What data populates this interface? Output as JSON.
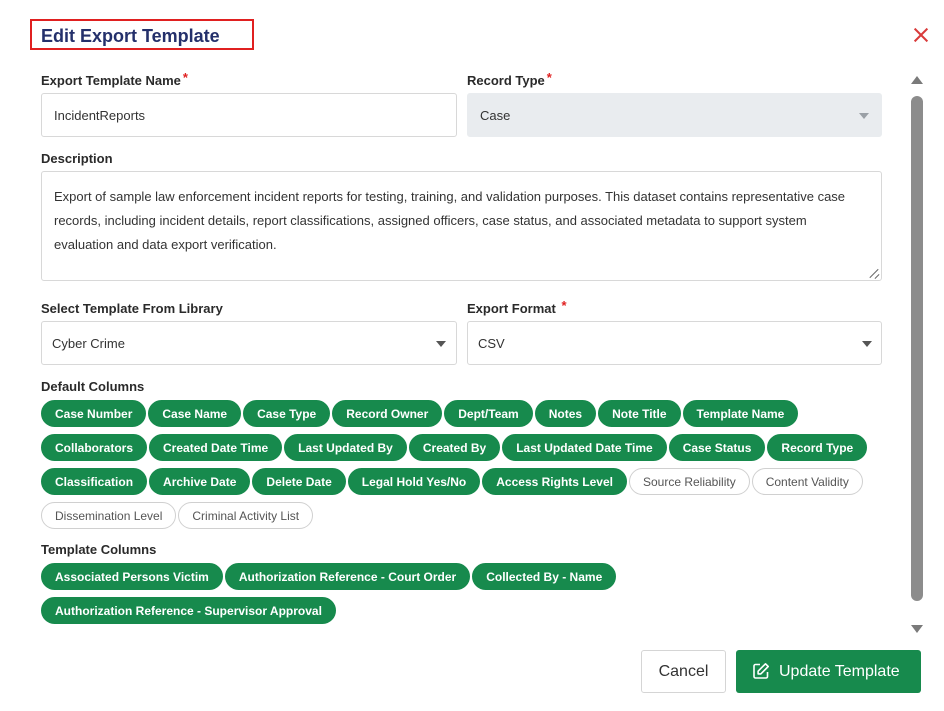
{
  "dialog": {
    "title": "Edit Export Template"
  },
  "fields": {
    "template_name": {
      "label": "Export Template Name",
      "required_mark": "*",
      "value": "IncidentReports"
    },
    "record_type": {
      "label": "Record Type",
      "required_mark": "*",
      "value": "Case",
      "disabled": true
    },
    "description": {
      "label": "Description",
      "value": "Export of sample law enforcement incident reports for testing, training, and validation purposes. This dataset contains representative case records, including incident details, report classifications, assigned officers, case status, and associated metadata to support system evaluation and data export verification."
    },
    "library_template": {
      "label": "Select Template From Library",
      "value": "Cyber Crime"
    },
    "export_format": {
      "label": "Export Format",
      "required_mark": "*",
      "value": "CSV"
    }
  },
  "default_columns": {
    "label": "Default Columns",
    "chips": [
      {
        "label": "Case Number",
        "selected": true
      },
      {
        "label": "Case Name",
        "selected": true
      },
      {
        "label": "Case Type",
        "selected": true
      },
      {
        "label": "Record Owner",
        "selected": true
      },
      {
        "label": "Dept/Team",
        "selected": true
      },
      {
        "label": "Notes",
        "selected": true
      },
      {
        "label": "Note Title",
        "selected": true
      },
      {
        "label": "Template Name",
        "selected": true
      },
      {
        "label": "Collaborators",
        "selected": true
      },
      {
        "label": "Created Date Time",
        "selected": true
      },
      {
        "label": "Last Updated By",
        "selected": true
      },
      {
        "label": "Created By",
        "selected": true
      },
      {
        "label": "Last Updated Date Time",
        "selected": true
      },
      {
        "label": "Case Status",
        "selected": true
      },
      {
        "label": "Record Type",
        "selected": true
      },
      {
        "label": "Classification",
        "selected": true
      },
      {
        "label": "Archive Date",
        "selected": true
      },
      {
        "label": "Delete Date",
        "selected": true
      },
      {
        "label": "Legal Hold Yes/No",
        "selected": true
      },
      {
        "label": "Access Rights Level",
        "selected": true
      },
      {
        "label": "Source Reliability",
        "selected": false
      },
      {
        "label": "Content Validity",
        "selected": false
      },
      {
        "label": "Dissemination Level",
        "selected": false
      },
      {
        "label": "Criminal Activity List",
        "selected": false
      }
    ]
  },
  "template_columns": {
    "label": "Template Columns",
    "chips": [
      {
        "label": "Associated Persons Victim",
        "selected": true
      },
      {
        "label": "Authorization Reference - Court Order",
        "selected": true
      },
      {
        "label": "Collected By - Name",
        "selected": true
      },
      {
        "label": "Authorization Reference - Supervisor Approval",
        "selected": true
      }
    ]
  },
  "actions": {
    "cancel_label": "Cancel",
    "update_label": "Update Template"
  },
  "colors": {
    "accent_green": "#178a4d",
    "title_navy": "#24306b",
    "required_red": "#e02020"
  },
  "icons": {
    "close": "close-icon",
    "edit": "edit-icon",
    "dropdown": "chevron-down-icon"
  }
}
